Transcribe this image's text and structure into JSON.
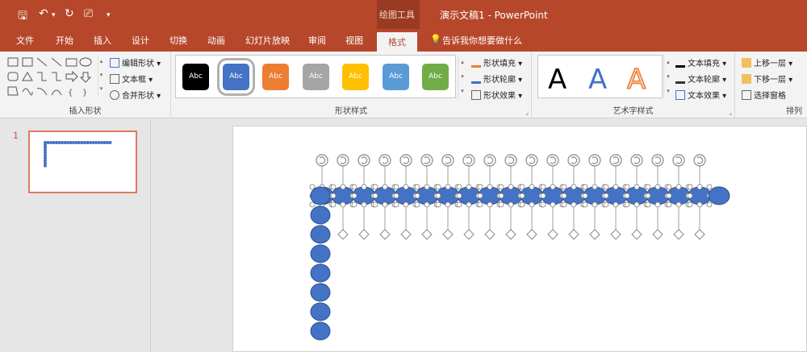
{
  "qa": {
    "undo_arrow": "▾",
    "more": "▾"
  },
  "title": {
    "context_group": "绘图工具",
    "document": "演示文稿1  -  PowerPoint"
  },
  "tabs": [
    "文件",
    "开始",
    "插入",
    "设计",
    "切换",
    "动画",
    "幻灯片放映",
    "审阅",
    "视图",
    "格式"
  ],
  "tell_me": "告诉我你想要做什么",
  "ribbon": {
    "insert_shapes": {
      "label": "插入形状",
      "edit_shape": "编辑形状",
      "text_box": "文本框",
      "merge_shapes": "合并形状"
    },
    "shape_styles": {
      "label": "形状样式",
      "swatch_text": "Abc",
      "swatches": [
        "#000000",
        "#4472c4",
        "#ed7d31",
        "#a5a5a5",
        "#ffc000",
        "#5b9bd5",
        "#70ad47"
      ],
      "fill": "形状填充",
      "outline": "形状轮廓",
      "effects": "形状效果"
    },
    "wordart": {
      "label": "艺术字样式",
      "letter": "A",
      "text_fill": "文本填充",
      "text_outline": "文本轮廓",
      "text_effects": "文本效果"
    },
    "arrange": {
      "label": "排列",
      "bring_forward": "上移一层",
      "send_backward": "下移一层",
      "selection_pane": "选择窗格"
    }
  },
  "thumbnails": [
    {
      "number": "1"
    }
  ],
  "slide": {
    "shape_color": "#4472c4",
    "outline_color": "#2f528f"
  }
}
